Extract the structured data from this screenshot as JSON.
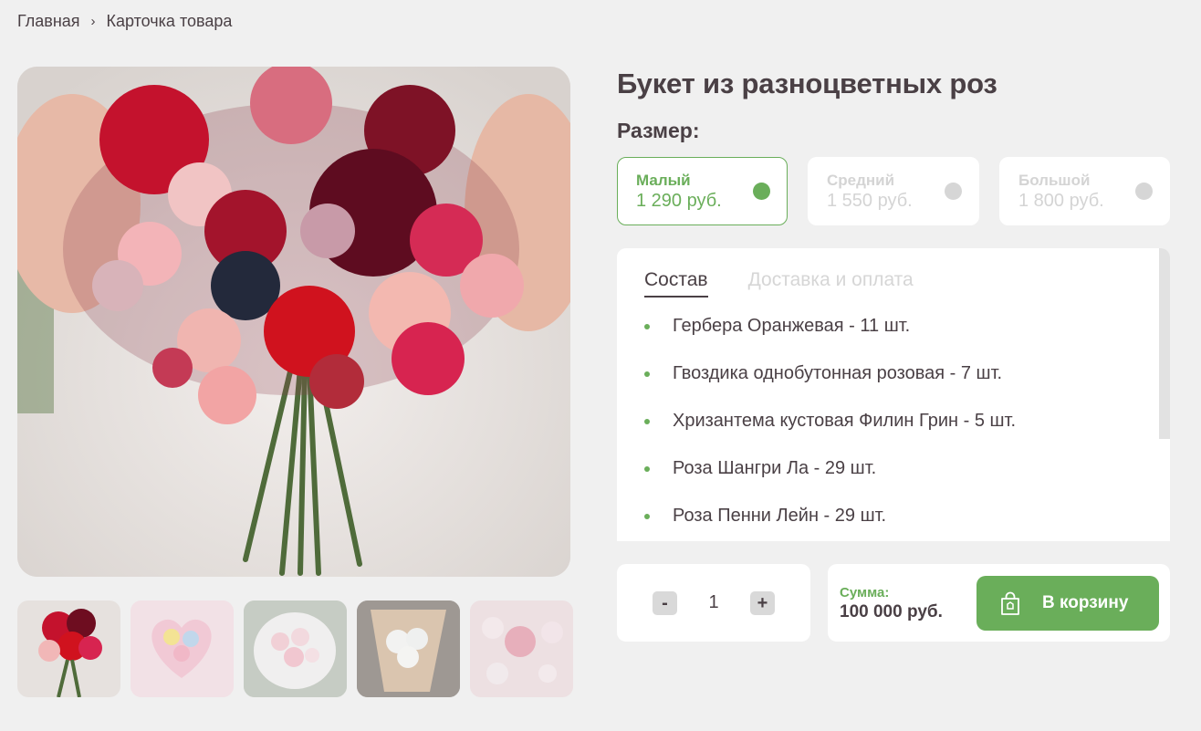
{
  "breadcrumb": {
    "home": "Главная",
    "separator": "›",
    "current": "Карточка товара"
  },
  "product": {
    "title": "Букет из разноцветных роз",
    "size_label": "Размер:"
  },
  "sizes": [
    {
      "name": "Малый",
      "price": "1 290 руб.",
      "selected": true
    },
    {
      "name": "Средний",
      "price": "1 550 руб.",
      "selected": false
    },
    {
      "name": "Большой",
      "price": "1 800 руб.",
      "selected": false
    }
  ],
  "tabs": [
    {
      "label": "Состав",
      "active": true
    },
    {
      "label": "Доставка и оплата",
      "active": false
    }
  ],
  "composition": [
    "Гербера Оранжевая - 11 шт.",
    "Гвоздика однобутонная розовая - 7 шт.",
    "Хризантема кустовая Филин Грин - 5 шт.",
    "Роза Шангри Ла - 29 шт.",
    "Роза Пенни Лейн - 29 шт."
  ],
  "quantity": {
    "minus": "-",
    "value": "1",
    "plus": "+"
  },
  "summary": {
    "label": "Сумма:",
    "value": "100 000 руб."
  },
  "cart_button": "В корзину",
  "colors": {
    "accent": "#6aae5a",
    "text": "#4a4045",
    "background": "#f0f0f0"
  },
  "images": {
    "main": "bouquet-photo",
    "thumbnails": [
      "bouquet-red",
      "bouquet-heart",
      "bouquet-pink-white",
      "bouquet-white",
      "bouquet-pink-daisies"
    ]
  }
}
